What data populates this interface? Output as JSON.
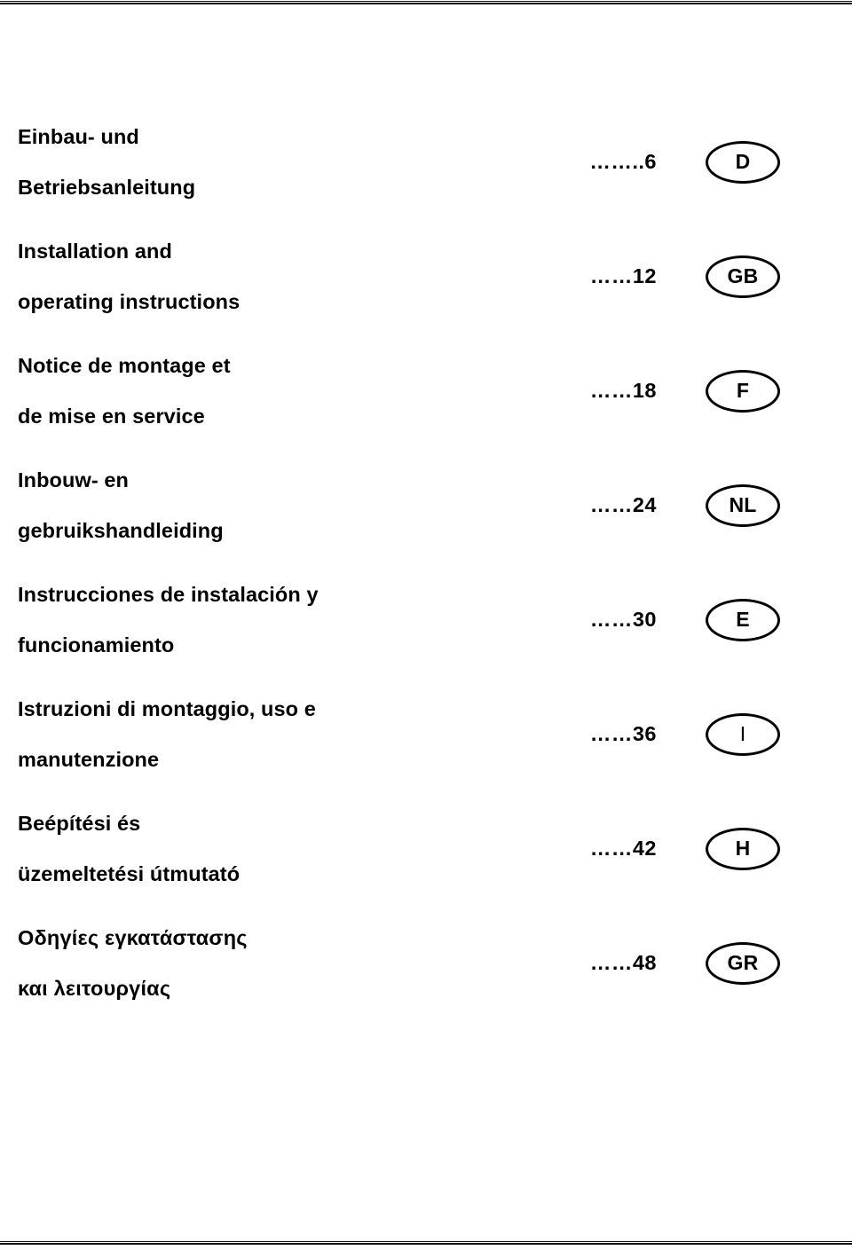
{
  "document": {
    "kind": "multilingual-manual-cover",
    "rules": {
      "top": "horizontal-rule",
      "bottom": "horizontal-rule"
    }
  },
  "toc": {
    "rows": [
      {
        "title": "Einbau- und\nBetriebsanleitung",
        "page": "……..6",
        "page_number": "6",
        "badge": "D",
        "badge_style": "bold"
      },
      {
        "title": "Installation and\noperating instructions",
        "page": "……12",
        "page_number": "12",
        "badge": "GB",
        "badge_style": "bold"
      },
      {
        "title": "Notice de montage et\nde mise en service",
        "page": "……18",
        "page_number": "18",
        "badge": "F",
        "badge_style": "bold"
      },
      {
        "title": "Inbouw- en\ngebruikshandleiding",
        "page": "……24",
        "page_number": "24",
        "badge": "NL",
        "badge_style": "bold"
      },
      {
        "title": "Instrucciones de instalación y\nfuncionamiento",
        "page": "……30",
        "page_number": "30",
        "badge": "E",
        "badge_style": "bold"
      },
      {
        "title": "Istruzioni di montaggio, uso e\nmanutenzione",
        "page": "……36",
        "page_number": "36",
        "badge": "I",
        "badge_style": "thin"
      },
      {
        "title": "Beépítési és\nüzemeltetési útmutató",
        "page": "……42",
        "page_number": "42",
        "badge": "H",
        "badge_style": "bold"
      },
      {
        "title": "Οδηγίες εγκατάστασης\nκαι λειτουργίας",
        "page": "……48",
        "page_number": "48",
        "badge": "GR",
        "badge_style": "bold"
      }
    ]
  }
}
